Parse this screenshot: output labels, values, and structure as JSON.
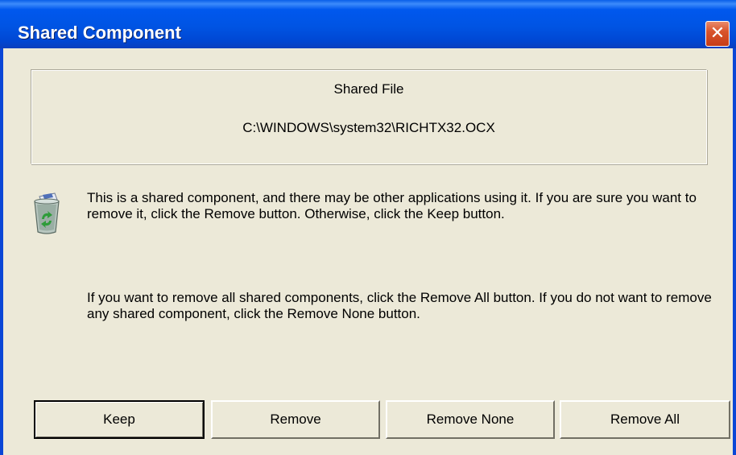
{
  "window": {
    "title": "Shared Component",
    "close_glyph": "✕"
  },
  "file_group": {
    "heading": "Shared File",
    "path": "C:\\WINDOWS\\system32\\RICHTX32.OCX"
  },
  "icon": "recycle-bin-icon",
  "messages": {
    "line1": "This is a shared component, and there may be other applications using it.  If you are sure you want to remove it, click the Remove button.  Otherwise, click the Keep button.",
    "line2": "If you want to remove all shared components, click the Remove All button.  If you do not want to remove any shared component, click the Remove None button."
  },
  "buttons": {
    "keep": "Keep",
    "remove": "Remove",
    "remove_none": "Remove None",
    "remove_all": "Remove All"
  },
  "colors": {
    "titlebar": "#0054e3",
    "window_bg": "#ece9d8",
    "close_button": "#d9542d"
  }
}
